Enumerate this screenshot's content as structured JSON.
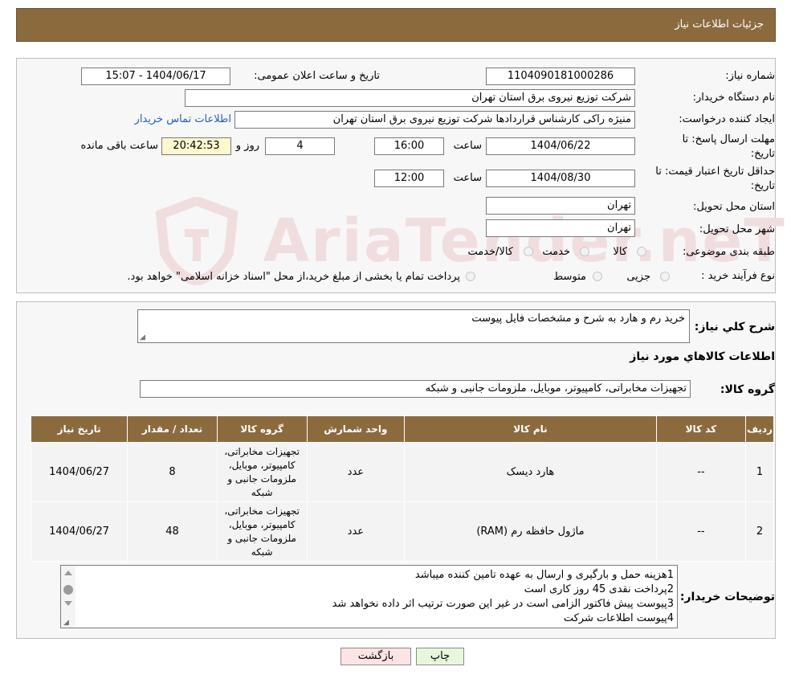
{
  "header": {
    "title": "جزئیات اطلاعات نیاز"
  },
  "fields": {
    "need_number_label": "شماره نیاز:",
    "need_number": "1104090181000286",
    "announce_label": "تاریخ و ساعت اعلان عمومی:",
    "announce_value": "1404/06/17 - 15:07",
    "buyer_org_label": "نام دستگاه خریدار:",
    "buyer_org": "شرکت توزیع نیروی برق استان تهران",
    "creator_label": "ایجاد کننده درخواست:",
    "creator": "منیژه راکی کارشناس قراردادها شرکت توزیع نیروی برق استان تهران",
    "contact_link": "اطلاعات تماس خریدار",
    "deadline_label_1": "مهلت ارسال پاسخ: تا",
    "deadline_label_2": "تاریخ:",
    "deadline_date": "1404/06/22",
    "time_label": "ساعت",
    "deadline_time": "16:00",
    "days_value": "4",
    "days_label": "روز و",
    "remaining_time": "20:42:53",
    "remaining_label": "ساعت باقی مانده",
    "validity_label_1": "حداقل تاریخ اعتبار قیمت: تا",
    "validity_label_2": "تاریخ:",
    "validity_date": "1404/08/30",
    "validity_time_label": "ساعت",
    "validity_time": "12:00",
    "province_label": "استان محل تحویل:",
    "province": "تهران",
    "city_label": "شهر محل تحویل:",
    "city": "تهران",
    "category_label": "طبقه بندی موضوعی:",
    "category_options": [
      "کالا",
      "خدمت",
      "کالا/خدمت"
    ],
    "process_label": "نوع فرآیند خرید :",
    "process_options": [
      "جزیی",
      "متوسط"
    ],
    "process_note": "پرداخت تمام یا بخشی از مبلغ خرید،از محل \"اسناد خزانه اسلامی\" خواهد بود."
  },
  "watermark": "AriaTender.neT",
  "summary": {
    "desc_label": "شرح کلي نیاز:",
    "desc_value": "خرید رم و هارد به شرح و مشخصات فایل پیوست",
    "goods_info_title": "اطلاعات کالاهاي مورد نیاز",
    "group_label": "گروه کالا:",
    "group_value": "تجهیزات مخابراتی، کامپیوتر، موبایل، ملزومات جانبی و شبکه"
  },
  "table": {
    "headers": [
      "ردیف",
      "کد کالا",
      "نام کالا",
      "واحد شمارش",
      "گروه کالا",
      "تعداد / مقدار",
      "تاریخ نیاز"
    ],
    "rows": [
      {
        "row": "1",
        "code": "--",
        "name": "هارد دیسک",
        "unit": "عدد",
        "group": "تجهیزات مخابراتی، کامپیوتر، موبایل، ملزومات جانبی و شبکه",
        "qty": "8",
        "date": "1404/06/27"
      },
      {
        "row": "2",
        "code": "--",
        "name": "ماژول حافظه رم (RAM)",
        "unit": "عدد",
        "group": "تجهیزات مخابراتی، کامپیوتر، موبایل، ملزومات جانبی و شبکه",
        "qty": "48",
        "date": "1404/06/27"
      }
    ]
  },
  "buyer_notes": {
    "label": "توضیحات خریدار:",
    "lines": [
      "1هزینه حمل و بارگیری و ارسال به عهده تامین کننده میباشد",
      "2پرداخت نقدی 45 روز کاری است",
      "3پیوست پیش فاکتور الزامی است در غیر این صورت ترتیب اثر داده نخواهد شد",
      "4پیوست اطلاعات شرکت"
    ]
  },
  "buttons": {
    "back": "بازگشت",
    "print": "چاپ"
  },
  "colors": {
    "header_bg": "#8b6b3e",
    "link": "#1f5fbf",
    "back_button_bg": "#fde4e4",
    "print_button_bg": "#e8f7dc"
  }
}
